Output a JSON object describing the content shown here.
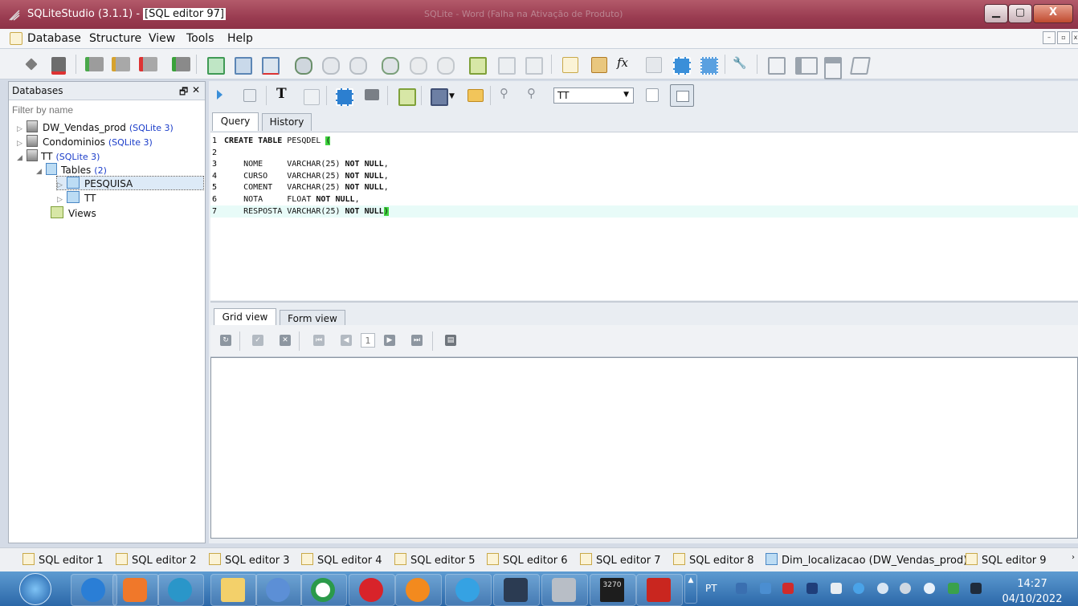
{
  "window": {
    "title_app": "SQLiteStudio (3.1.1) -",
    "title_doc": "[SQL editor 97]",
    "ghost_title": "SQLite - Word (Falha na Ativação de Produto)",
    "min": "▁",
    "max": "▢",
    "close": "X"
  },
  "menu": [
    "Database",
    "Structure",
    "View",
    "Tools",
    "Help"
  ],
  "databases": {
    "title": "Databases",
    "float_icon": "🗗",
    "close_icon": "✕",
    "filter_placeholder": "Filter by name",
    "items": [
      {
        "name": "DW_Vendas_prod",
        "type": "(SQLite 3)"
      },
      {
        "name": "Condominios",
        "type": "(SQLite 3)"
      },
      {
        "name": "TT",
        "type": "(SQLite 3)"
      }
    ],
    "tables_label": "Tables",
    "tables_count": "(2)",
    "table1": "PESQUISA",
    "table2": "TT",
    "views_label": "Views"
  },
  "editor": {
    "db_select": "TT",
    "tabs": [
      "Query",
      "History"
    ],
    "lines": [
      {
        "n": "1",
        "parts": [
          {
            "t": "CREATE TABLE",
            "kw": true
          },
          {
            "t": " PESQDEL "
          },
          {
            "t": "(",
            "paren": true
          }
        ]
      },
      {
        "n": "2",
        "parts": []
      },
      {
        "n": "3",
        "parts": [
          {
            "t": "    NOME     VARCHAR(25) "
          },
          {
            "t": "NOT NULL",
            "kw": true
          },
          {
            "t": ","
          }
        ]
      },
      {
        "n": "4",
        "parts": [
          {
            "t": "    CURSO    VARCHAR(25) "
          },
          {
            "t": "NOT NULL",
            "kw": true
          },
          {
            "t": ","
          }
        ]
      },
      {
        "n": "5",
        "parts": [
          {
            "t": "    COMENT   VARCHAR(25) "
          },
          {
            "t": "NOT NULL",
            "kw": true
          },
          {
            "t": ","
          }
        ]
      },
      {
        "n": "6",
        "parts": [
          {
            "t": "    NOTA     FLOAT "
          },
          {
            "t": "NOT NULL",
            "kw": true
          },
          {
            "t": ","
          }
        ]
      },
      {
        "n": "7",
        "parts": [
          {
            "t": "    RESPOSTA VARCHAR(25) "
          },
          {
            "t": "NOT NULL",
            "kw": true
          },
          {
            "t": ")",
            "paren": true
          }
        ]
      }
    ]
  },
  "results": {
    "tabs": [
      "Grid view",
      "Form view"
    ],
    "page": "1"
  },
  "bottom_tabs": [
    "SQL editor 1",
    "SQL editor 2",
    "SQL editor 3",
    "SQL editor 4",
    "SQL editor 5",
    "SQL editor 6",
    "SQL editor 7",
    "SQL editor 8",
    "Dim_localizacao (DW_Vendas_prod)",
    "SQL editor 9"
  ],
  "taskbar": {
    "lang": "PT",
    "time": "14:27",
    "date": "04/10/2022",
    "mainframe_label": "3270"
  }
}
